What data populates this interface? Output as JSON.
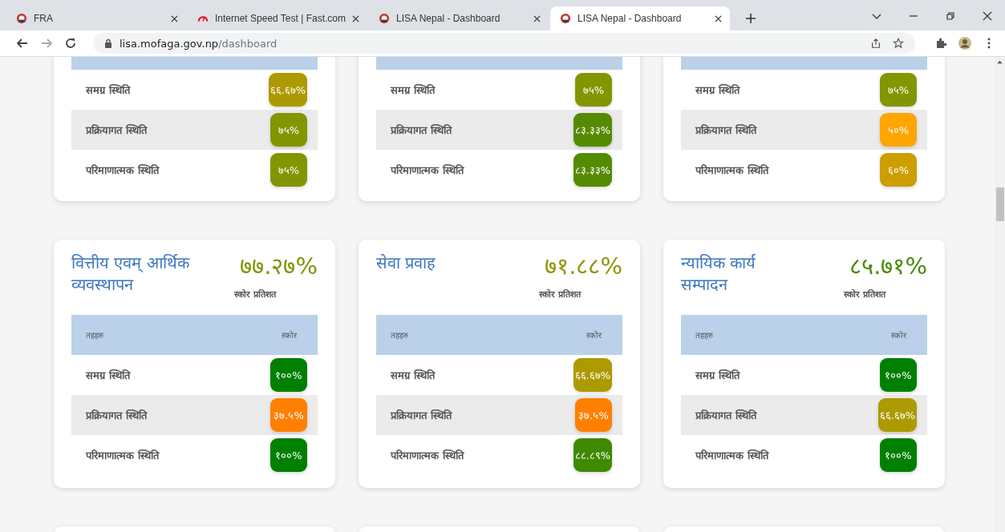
{
  "browser": {
    "tabs": [
      {
        "title": "FRA",
        "selected": false,
        "kind": "emblem"
      },
      {
        "title": "Internet Speed Test | Fast.com",
        "selected": false,
        "kind": "gauge"
      },
      {
        "title": "LISA Nepal - Dashboard",
        "selected": false,
        "kind": "emblem"
      },
      {
        "title": "LISA Nepal - Dashboard",
        "selected": true,
        "kind": "emblem"
      }
    ],
    "address": {
      "host": "lisa.mofaga.gov.np",
      "path": "/dashboard"
    }
  },
  "card_rows": [
    {
      "cards": [
        {
          "rows": [
            {
              "label": "समग्र स्थिति",
              "score": "६६.६७%",
              "color": "#ad9a00"
            },
            {
              "label": "प्रक्रियागत स्थिति",
              "score": "७५%",
              "color": "#829600"
            },
            {
              "label": "परिमाणात्मक स्थिति",
              "score": "७५%",
              "color": "#829600"
            }
          ]
        },
        {
          "rows": [
            {
              "label": "समग्र स्थिति",
              "score": "७५%",
              "color": "#829600"
            },
            {
              "label": "प्रक्रियागत स्थिति",
              "score": "८३.३३%",
              "color": "#558b00"
            },
            {
              "label": "परिमाणात्मक स्थिति",
              "score": "८३.३३%",
              "color": "#558b00"
            }
          ]
        },
        {
          "rows": [
            {
              "label": "समग्र स्थिति",
              "score": "७५%",
              "color": "#829600"
            },
            {
              "label": "प्रक्रियागत स्थिति",
              "score": "५०%",
              "color": "#ffa500"
            },
            {
              "label": "परिमाणात्मक स्थिति",
              "score": "६०%",
              "color": "#cc9e00"
            }
          ]
        }
      ]
    },
    {
      "cards": [
        {
          "title": "वित्तीय एवम् आर्थिक व्यवस्थापन",
          "total": "७७.२७%",
          "color": "#7f9400",
          "total_label": "स्कोर प्रतिशत",
          "columns": [
            "तहहरु",
            "स्कोर"
          ],
          "rows": [
            {
              "label": "समग्र स्थिति",
              "score": "१००%",
              "color": "#008000"
            },
            {
              "label": "प्रक्रियागत स्थिति",
              "score": "३७.५%",
              "color": "#ff8000"
            },
            {
              "label": "परिमाणात्मक स्थिति",
              "score": "१००%",
              "color": "#008000"
            }
          ]
        },
        {
          "title": "सेवा प्रवाह",
          "total": "७१.८८%",
          "color": "#8f9600",
          "total_label": "स्कोर प्रतिशत",
          "columns": [
            "तहहरु",
            "स्कोर"
          ],
          "rows": [
            {
              "label": "समग्र स्थिति",
              "score": "६६.६७%",
              "color": "#ad9a00"
            },
            {
              "label": "प्रक्रियागत स्थिति",
              "score": "३७.५%",
              "color": "#ff8000"
            },
            {
              "label": "परिमाणात्मक स्थिति",
              "score": "८८.८९%",
              "color": "#3f8a00"
            }
          ]
        },
        {
          "title": "न्यायिक कार्य सम्पादन",
          "total": "८५.७१%",
          "color": "#4a8a00",
          "total_label": "स्कोर प्रतिशत",
          "columns": [
            "तहहरु",
            "स्कोर"
          ],
          "rows": [
            {
              "label": "समग्र स्थिति",
              "score": "१००%",
              "color": "#008000"
            },
            {
              "label": "प्रक्रियागत स्थिति",
              "score": "६६.६७%",
              "color": "#ad9a00"
            },
            {
              "label": "परिमाणात्मक स्थिति",
              "score": "१००%",
              "color": "#008000"
            }
          ]
        }
      ]
    }
  ]
}
